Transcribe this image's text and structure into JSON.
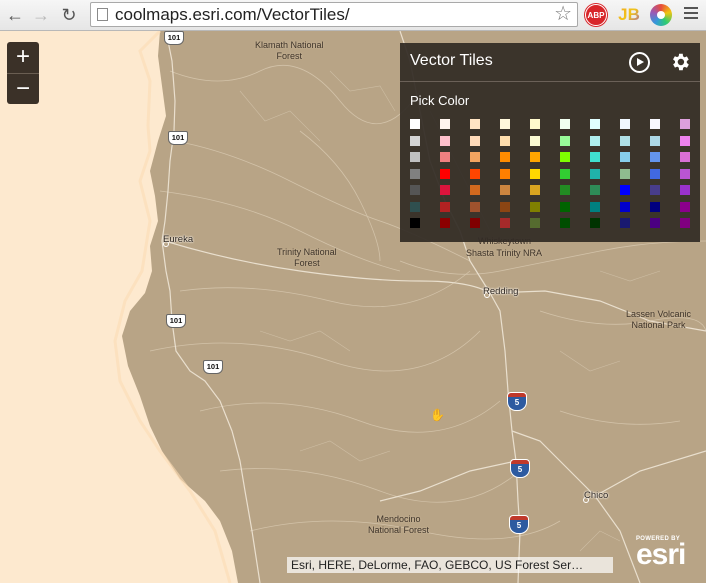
{
  "browser": {
    "url": "coolmaps.esri.com/VectorTiles/",
    "ext_abp_label": "ABP",
    "ext_jb_label": "JB"
  },
  "zoom": {
    "in_label": "+",
    "out_label": "−"
  },
  "panel": {
    "title": "Vector Tiles",
    "pick_color_label": "Pick Color",
    "swatch_columns": [
      [
        "#ffffff",
        "#d3d3d3",
        "#c0c0c0",
        "#808080",
        "#555555",
        "#2f4f4f",
        "#000000"
      ],
      [
        "#fff5ee",
        "#ffc0cb",
        "#f08080",
        "#ff0000",
        "#dc143c",
        "#b22222",
        "#8b0000"
      ],
      [
        "#ffe4c4",
        "#ffdab9",
        "#f4a460",
        "#ff4500",
        "#d2691e",
        "#a0522d",
        "#800000"
      ],
      [
        "#fff8dc",
        "#ffdead",
        "#ff8c00",
        "#ff7f00",
        "#cd853f",
        "#8b4513",
        "#a52a2a"
      ],
      [
        "#fffacd",
        "#fafad2",
        "#ffa500",
        "#ffd700",
        "#daa520",
        "#808000",
        "#556b2f"
      ],
      [
        "#f0fff0",
        "#98fb98",
        "#7fff00",
        "#32cd32",
        "#228b22",
        "#006400",
        "#004d00"
      ],
      [
        "#e0ffff",
        "#afeeee",
        "#40e0d0",
        "#20b2aa",
        "#2e8b57",
        "#008080",
        "#003300"
      ],
      [
        "#f0f8ff",
        "#b0e0e6",
        "#87ceeb",
        "#8fbc8f",
        "#0000ff",
        "#0000cd",
        "#191970"
      ],
      [
        "#f8f8ff",
        "#add8e6",
        "#6495ed",
        "#4169e1",
        "#483d8b",
        "#000080",
        "#4b0082"
      ],
      [
        "#dda0dd",
        "#ee82ee",
        "#da70d6",
        "#ba55d3",
        "#9932cc",
        "#8b008b",
        "#800080"
      ]
    ]
  },
  "map_labels": {
    "klamath": "Klamath National\nForest",
    "trinity": "Trinity National\nForest",
    "whiskeytown": "Whiskeytown",
    "shasta": "Shasta Trinity NRA",
    "lassen": "Lassen Volcanic\nNational Park",
    "mendocino": "Mendocino\nNational Forest",
    "eureka": "Eureka",
    "redding": "Redding",
    "chico": "Chico"
  },
  "shields": {
    "us101": "101",
    "i5": "5"
  },
  "attribution": "Esri, HERE, DeLorme, FAO, GEBCO, US Forest Ser…",
  "esri": {
    "powered_by": "POWERED BY",
    "brand": "esri"
  }
}
